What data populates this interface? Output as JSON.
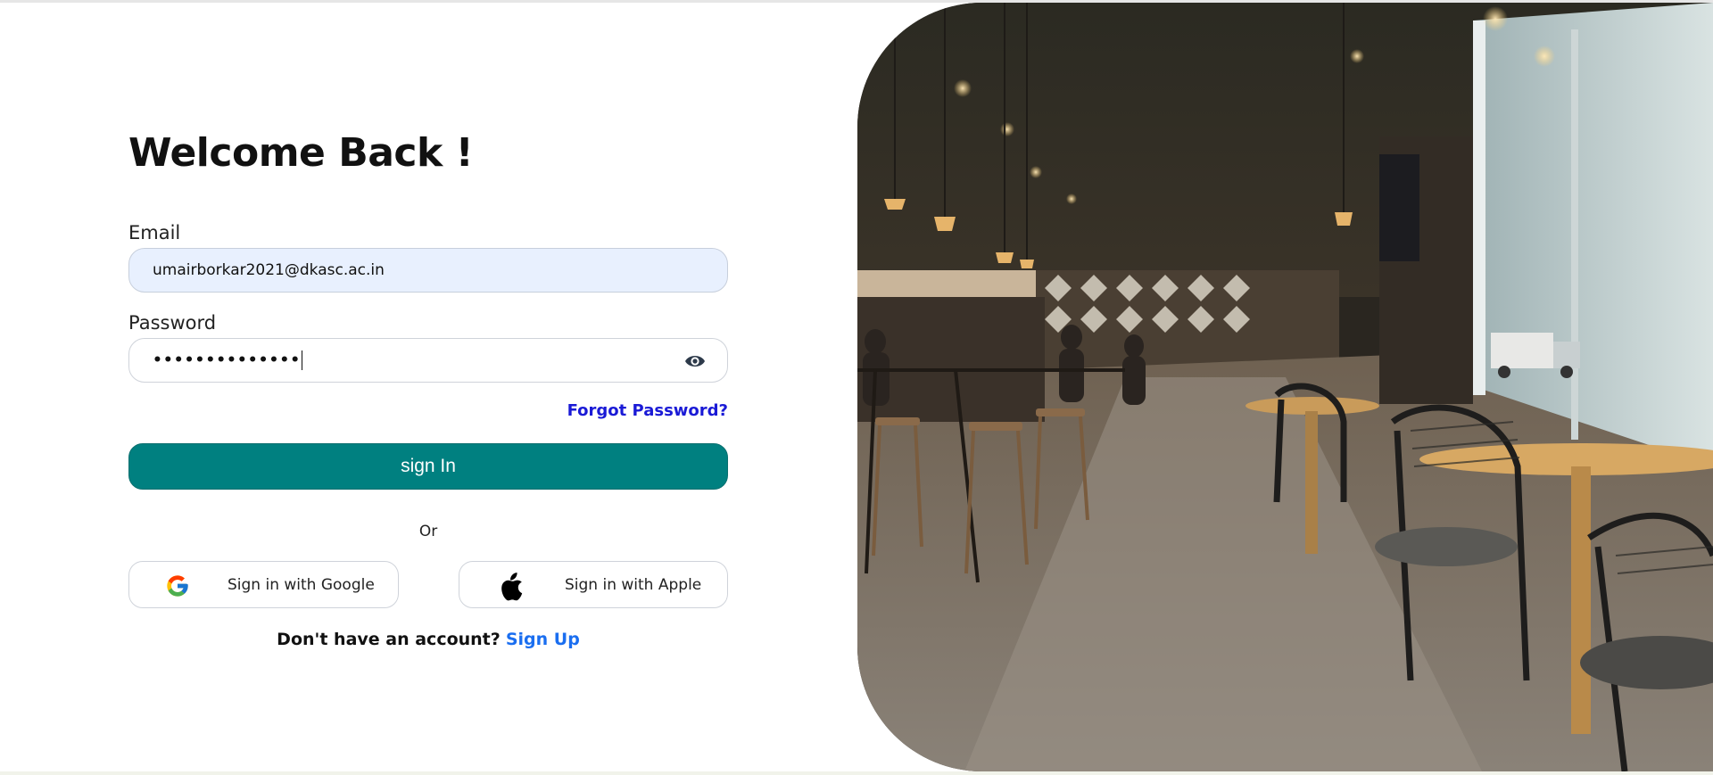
{
  "login": {
    "heading": "Welcome Back !",
    "email_label": "Email",
    "email_value": "umairborkar2021@dkasc.ac.in",
    "password_label": "Password",
    "password_masked": "••••••••••••••",
    "forgot_link": "Forgot Password?",
    "signin_button": "sign In",
    "divider": "Or",
    "google_button": "Sign in with Google",
    "apple_button": "Sign in with Apple",
    "no_account_text": "Don't have an account?",
    "signup_link": "Sign Up"
  },
  "icons": {
    "password_toggle": "eye-icon",
    "google": "google-icon",
    "apple": "apple-icon"
  },
  "colors": {
    "primary": "#008080",
    "link": "#1a1ad6",
    "signup_link": "#1a6ef0",
    "autofill_bg": "#e8f0fe"
  }
}
